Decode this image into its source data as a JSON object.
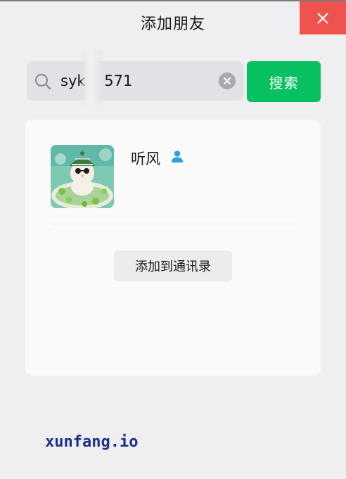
{
  "window": {
    "title": "添加朋友",
    "close_icon": "close-icon"
  },
  "search": {
    "value": "syk    571",
    "search_icon": "search-icon",
    "clear_icon": "clear-icon",
    "button_label": "搜索"
  },
  "result": {
    "username": "听风",
    "gender_icon": "person-icon",
    "avatar_icon": "avatar-image",
    "add_button_label": "添加到通讯录"
  },
  "watermark": {
    "text": "xunfang.io"
  },
  "colors": {
    "accent_green": "#07c160",
    "close_red": "#ef5350",
    "gender_blue": "#2d9fe0",
    "watermark_blue": "#1f2f86"
  }
}
